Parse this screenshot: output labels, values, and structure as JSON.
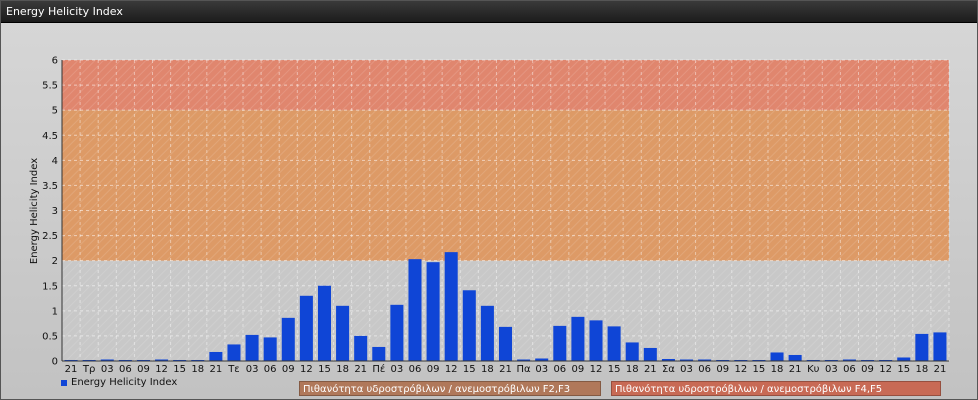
{
  "window": {
    "title": "Energy Helicity Index"
  },
  "colors": {
    "bar": "#0f45d6",
    "zone_low": "#c8c8c8",
    "zone_mid": "#dd9a66",
    "zone_high": "#e0866e",
    "legend_f2f3": "#b0785a",
    "legend_f4f5": "#c86a55"
  },
  "legend": {
    "series_label": "Energy Helicity Index",
    "zone_f2f3": "Πιθανότητα υδροστρόβιλων / ανεμοστρόβιλων F2,F3",
    "zone_f4f5": "Πιθανότητα υδροστρόβιλων / ανεμοστρόβιλων F4,F5"
  },
  "chart_data": {
    "type": "bar",
    "title": "",
    "ylabel": "Energy Helicity Index",
    "xlabel": "",
    "ylim": [
      0,
      6
    ],
    "yticks": [
      "0",
      "0.5",
      "1",
      "1.5",
      "2",
      "2.5",
      "3",
      "3.5",
      "4",
      "4.5",
      "5",
      "5.5",
      "6"
    ],
    "grid": true,
    "zones": [
      {
        "from": 0,
        "to": 2,
        "label": ""
      },
      {
        "from": 2,
        "to": 5,
        "label": "Πιθανότητα υδροστρόβιλων / ανεμοστρόβιλων F2,F3"
      },
      {
        "from": 5,
        "to": 6,
        "label": "Πιθανότητα υδροστρόβιλων / ανεμοστρόβιλων F4,F5"
      }
    ],
    "categories": [
      "21",
      "Τρ",
      "03",
      "06",
      "09",
      "12",
      "15",
      "18",
      "21",
      "Τε",
      "03",
      "06",
      "09",
      "12",
      "15",
      "18",
      "21",
      "Πέ",
      "03",
      "06",
      "09",
      "12",
      "15",
      "18",
      "21",
      "Πα",
      "03",
      "06",
      "09",
      "12",
      "15",
      "18",
      "21",
      "Σα",
      "03",
      "06",
      "09",
      "12",
      "15",
      "18",
      "21",
      "Κυ",
      "03",
      "06",
      "09",
      "12",
      "15",
      "18",
      "21"
    ],
    "series": [
      {
        "name": "Energy Helicity Index",
        "values": [
          0.02,
          0.02,
          0.03,
          0.02,
          0.02,
          0.03,
          0.02,
          0.02,
          0.18,
          0.33,
          0.52,
          0.47,
          0.86,
          1.3,
          1.5,
          1.1,
          0.5,
          0.28,
          1.12,
          2.03,
          1.97,
          2.17,
          1.41,
          1.1,
          0.68,
          0.03,
          0.05,
          0.7,
          0.88,
          0.81,
          0.69,
          0.37,
          0.26,
          0.04,
          0.03,
          0.03,
          0.02,
          0.02,
          0.02,
          0.17,
          0.12,
          0.02,
          0.02,
          0.03,
          0.02,
          0.02,
          0.07,
          0.54,
          0.57
        ]
      }
    ]
  }
}
